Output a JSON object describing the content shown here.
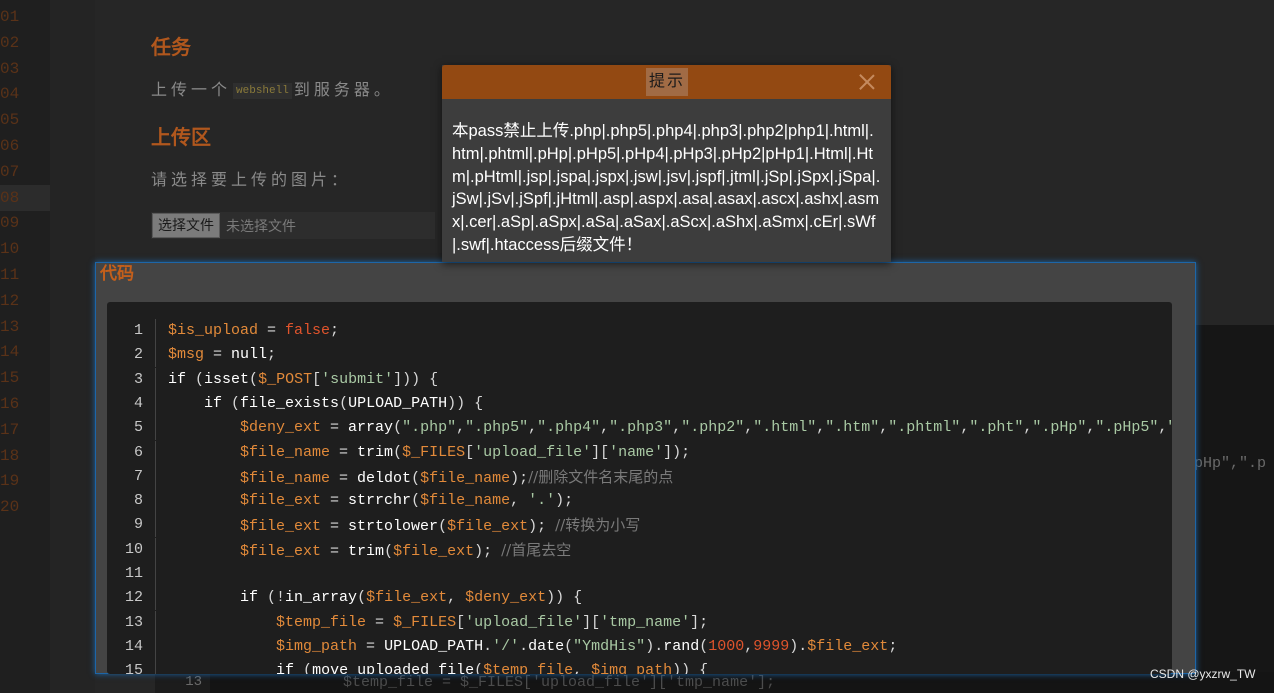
{
  "gutter_numbers": [
    "01",
    "02",
    "03",
    "04",
    "05",
    "06",
    "07",
    "08",
    "09",
    "10",
    "11",
    "12",
    "13",
    "14",
    "15",
    "16",
    "17",
    "18",
    "19",
    "20"
  ],
  "task": {
    "heading": "任务",
    "text_before": "上传一个",
    "inline_code": "webshell",
    "text_after": "到服务器。"
  },
  "upload": {
    "heading": "上传区",
    "prompt": "请选择要上传的图片：",
    "file_button": "选择文件",
    "file_status": "未选择文件"
  },
  "code": {
    "title": "代码",
    "lines": [
      {
        "n": "1",
        "html": "<span class='v'>$is_upload</span><span class='p'> = </span><span class='n'>false</span><span class='p'>;</span>"
      },
      {
        "n": "2",
        "html": "<span class='v'>$msg</span><span class='p'> = </span><span class='f'>null</span><span class='p'>;</span>"
      },
      {
        "n": "3",
        "html": "<span class='f'>if</span><span class='p'> (</span><span class='f'>isset</span><span class='p'>(</span><span class='v'>$_POST</span><span class='p'>[</span><span class='s'>'submit'</span><span class='p'>])) {</span>"
      },
      {
        "n": "4",
        "html": "    <span class='f'>if</span><span class='p'> (</span><span class='f'>file_exists</span><span class='p'>(</span><span class='f'>UPLOAD_PATH</span><span class='p'>)) {</span>"
      },
      {
        "n": "5",
        "html": "        <span class='v'>$deny_ext</span><span class='p'> = </span><span class='f'>array</span><span class='p'>(</span><span class='s'>\".php\"</span><span class='p'>,</span><span class='s'>\".php5\"</span><span class='p'>,</span><span class='s'>\".php4\"</span><span class='p'>,</span><span class='s'>\".php3\"</span><span class='p'>,</span><span class='s'>\".php2\"</span><span class='p'>,</span><span class='s'>\".html\"</span><span class='p'>,</span><span class='s'>\".htm\"</span><span class='p'>,</span><span class='s'>\".phtml\"</span><span class='p'>,</span><span class='s'>\".pht\"</span><span class='p'>,</span><span class='s'>\".pHp\"</span><span class='p'>,</span><span class='s'>\".pHp5\"</span><span class='p'>,</span><span class='s'>\".</span>"
      },
      {
        "n": "6",
        "html": "        <span class='v'>$file_name</span><span class='p'> = </span><span class='f'>trim</span><span class='p'>(</span><span class='v'>$_FILES</span><span class='p'>[</span><span class='s'>'upload_file'</span><span class='p'>][</span><span class='s'>'name'</span><span class='p'>]);</span>"
      },
      {
        "n": "7",
        "html": "        <span class='v'>$file_name</span><span class='p'> = </span><span class='f'>deldot</span><span class='p'>(</span><span class='v'>$file_name</span><span class='p'>);</span><span class='c'>//删除文件名末尾的点</span>"
      },
      {
        "n": "8",
        "html": "        <span class='v'>$file_ext</span><span class='p'> = </span><span class='f'>strrchr</span><span class='p'>(</span><span class='v'>$file_name</span><span class='p'>, </span><span class='s'>'.'</span><span class='p'>);</span>"
      },
      {
        "n": "9",
        "html": "        <span class='v'>$file_ext</span><span class='p'> = </span><span class='f'>strtolower</span><span class='p'>(</span><span class='v'>$file_ext</span><span class='p'>); </span><span class='c'>//转换为小写</span>"
      },
      {
        "n": "10",
        "html": "        <span class='v'>$file_ext</span><span class='p'> = </span><span class='f'>trim</span><span class='p'>(</span><span class='v'>$file_ext</span><span class='p'>); </span><span class='c'>//首尾去空</span>"
      },
      {
        "n": "11",
        "html": ""
      },
      {
        "n": "12",
        "html": "        <span class='f'>if</span><span class='p'> (!</span><span class='f'>in_array</span><span class='p'>(</span><span class='v'>$file_ext</span><span class='p'>, </span><span class='v'>$deny_ext</span><span class='p'>)) {</span>"
      },
      {
        "n": "13",
        "html": "            <span class='v'>$temp_file</span><span class='p'> = </span><span class='v'>$_FILES</span><span class='p'>[</span><span class='s'>'upload_file'</span><span class='p'>][</span><span class='s'>'tmp_name'</span><span class='p'>];</span>"
      },
      {
        "n": "14",
        "html": "            <span class='v'>$img_path</span><span class='p'> = </span><span class='f'>UPLOAD_PATH</span><span class='p'>.</span><span class='s'>'/'</span><span class='p'>.</span><span class='f'>date</span><span class='p'>(</span><span class='s'>\"YmdHis\"</span><span class='p'>).</span><span class='f'>rand</span><span class='p'>(</span><span class='n'>1000</span><span class='p'>,</span><span class='n'>9999</span><span class='p'>).</span><span class='v'>$file_ext</span><span class='p'>;</span>"
      },
      {
        "n": "15",
        "html": "            <span class='f'>if</span><span class='p'> (</span><span class='f'>move_uploaded_file</span><span class='p'>(</span><span class='v'>$temp_file</span><span class='p'>, </span><span class='v'>$img_path</span><span class='p'>)) {</span>"
      }
    ]
  },
  "background": {
    "right_fragment": "pHp\",\".p",
    "bottom_line_number": "13",
    "bottom_line_text": "$temp_file = $_FILES['upload_file']['tmp_name'];"
  },
  "dialog": {
    "title": "提示",
    "message": "本pass禁止上传.php|.php5|.php4|.php3|.php2|php1|.html|.htm|.phtml|.pHp|.pHp5|.pHp4|.pHp3|.pHp2|pHp1|.Html|.Htm|.pHtml|.jsp|.jspa|.jspx|.jsw|.jsv|.jspf|.jtml|.jSp|.jSpx|.jSpa|.jSw|.jSv|.jSpf|.jHtml|.asp|.aspx|.asa|.asax|.ascx|.ashx|.asmx|.cer|.aSp|.aSpx|.aSa|.aSax|.aScx|.aShx|.aSmx|.cEr|.sWf|.swf|.htaccess后缀文件！"
  },
  "watermark": "CSDN @yxzrw_TW"
}
